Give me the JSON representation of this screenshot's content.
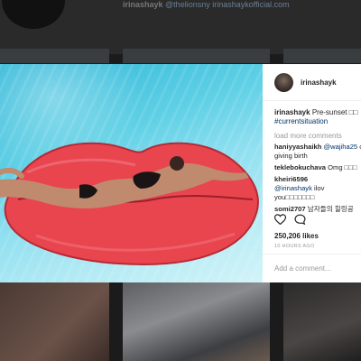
{
  "background": {
    "header_handle": "irinashayk",
    "header_mentions": "@thelionsny irinashaykofficial.com"
  },
  "post": {
    "username": "irinashayk",
    "caption_user": "irinashayk",
    "caption_text": "Pre-sunset □□",
    "caption_tag": "#currentsituation",
    "load_more": "load more comments",
    "comments": [
      {
        "user": "haniyyashaikh",
        "mention": "@wajiha25",
        "text": " c",
        "cont": "giving birth"
      },
      {
        "user": "teklebokuchava",
        "mention": "",
        "text": " Omg □□□",
        "cont": ""
      },
      {
        "user": "kheiri6596",
        "mention": "@irinashayk",
        "text": " ilov",
        "cont": "you□□□□□□□"
      },
      {
        "user": "somi2707",
        "mention": "",
        "text": " 남자들의 힐링공",
        "cont": ""
      }
    ],
    "likes": "250,206 likes",
    "time_ago": "10 HOURS AGO",
    "add_comment_placeholder": "Add a comment..."
  },
  "colors": {
    "accent_link": "#003569",
    "float_red": "#e8454f"
  },
  "icons": [
    "heart-icon",
    "comment-icon"
  ]
}
